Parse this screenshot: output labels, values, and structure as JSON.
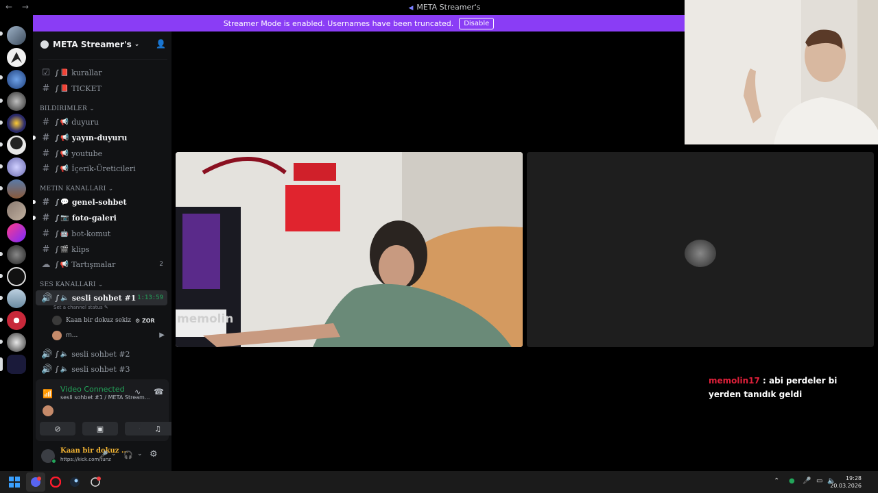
{
  "window": {
    "title": "META Streamer's",
    "back_icon": "←",
    "forward_icon": "→"
  },
  "banner": {
    "message": "Streamer Mode is enabled. Usernames have been truncated.",
    "disable_label": "Disable",
    "color": "#8a3df5"
  },
  "guild": {
    "name": "META Streamer's",
    "chevron": "⌄"
  },
  "categories": {
    "bildirimler": "BILDIRIMLER",
    "metin": "METIN KANALLARI",
    "ses": "SES KANALLARI"
  },
  "channels": [
    {
      "name": "kurallar",
      "emoji": "📕",
      "icon": "rules-icon"
    },
    {
      "name": "TICKET",
      "emoji": "📕",
      "icon": "hash-icon"
    },
    {
      "name": "duyuru",
      "emoji": "📢",
      "icon": "hash-icon"
    },
    {
      "name": "yayın-duyuru",
      "emoji": "📢",
      "icon": "hash-icon"
    },
    {
      "name": "youtube",
      "emoji": "📢",
      "icon": "hash-icon"
    },
    {
      "name": "İçerik-Üreticileri",
      "emoji": "📢",
      "icon": "hash-icon"
    },
    {
      "name": "genel-sohbet",
      "emoji": "💬",
      "icon": "hash-icon"
    },
    {
      "name": "foto-galeri",
      "emoji": "📷",
      "icon": "hash-icon"
    },
    {
      "name": "bot-komut",
      "emoji": "🤖",
      "icon": "hash-icon"
    },
    {
      "name": "klips",
      "emoji": "🎬",
      "icon": "hash-icon"
    },
    {
      "name": "Tartışmalar",
      "emoji": "📢",
      "icon": "forum-icon",
      "count": "2"
    }
  ],
  "voice": {
    "active_channel": "sesli sohbet #1",
    "timer": "1:13:59",
    "status_placeholder": "Set a channel status",
    "users": [
      {
        "name": "Kaan bir dokuz sekiz",
        "badge": "ZOR"
      },
      {
        "name": "m..."
      }
    ],
    "other_channels": [
      "sesli sohbet #2",
      "sesli sohbet #3"
    ]
  },
  "connection": {
    "status": "Video Connected",
    "location": "sesli sohbet #1 / META Stream...",
    "buttons": [
      "camera-off-icon",
      "screen-share-icon",
      "activities-icon",
      "soundboard-icon"
    ]
  },
  "user": {
    "name": "Kaan bir dokuz ...",
    "status": "https://kick.com/tunz"
  },
  "stage": {
    "overlay_text": "memolin"
  },
  "chat": {
    "username": "memolin17",
    "separator": " : ",
    "message": "abi perdeler bi yerden tanıdık geldi"
  },
  "taskbar": {
    "time": "19:28",
    "date": "20.03.2026"
  },
  "colors": {
    "accent_purple": "#8a3df5",
    "online_green": "#23a55a",
    "username_gold": "#f0b232",
    "chat_user_red": "#e0203a"
  }
}
